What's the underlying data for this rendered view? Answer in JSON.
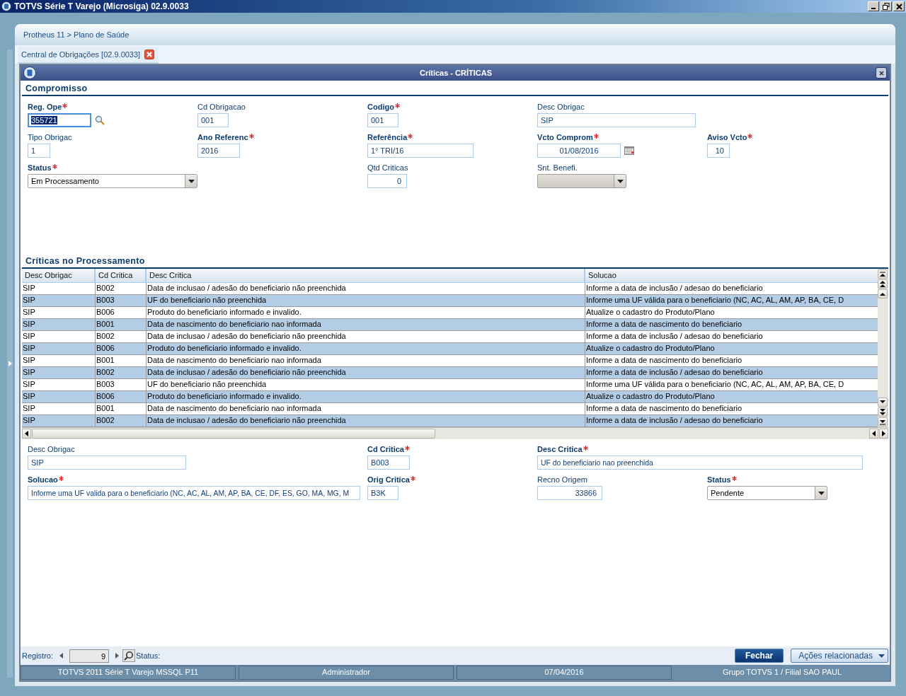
{
  "window": {
    "title": "TOTVS Série T Varejo (Microsiga) 02.9.0033"
  },
  "breadcrumb": "Protheus 11 > Plano de Saúde",
  "tabs": [
    {
      "label": "Central de Obrigações [02.9.0033]",
      "selected": true
    }
  ],
  "dialog": {
    "title": "Críticas - CRÍTICAS",
    "header_section": {
      "title": "Compromisso",
      "fields": [
        {
          "label": "Reg. Ope",
          "required": true,
          "kind": "lookup",
          "value": "355721",
          "focused": true,
          "disabled": false
        },
        {
          "label": "Cd Obrigacao",
          "required": false,
          "kind": "text",
          "value": "001",
          "focused": false,
          "disabled": false
        },
        {
          "label": "Codigo",
          "required": true,
          "kind": "text",
          "value": "001",
          "focused": false,
          "disabled": false
        },
        {
          "label": "Desc Obrigac",
          "required": false,
          "kind": "text",
          "value": "SIP",
          "focused": false,
          "disabled": false
        },
        {
          "label": "Tipo Obrigac",
          "required": false,
          "kind": "text",
          "value": "1",
          "focused": false,
          "disabled": false
        },
        {
          "label": "Ano Referenc",
          "required": true,
          "kind": "text",
          "value": "2016",
          "focused": false,
          "disabled": false
        },
        {
          "label": "Referência",
          "required": true,
          "kind": "text",
          "value": "1° TRI/16",
          "focused": false,
          "disabled": false
        },
        {
          "label": "Vcto Comprom",
          "required": true,
          "kind": "date",
          "value": "01/08/2016",
          "focused": false,
          "disabled": false
        },
        {
          "label": "Aviso Vcto",
          "required": true,
          "kind": "number",
          "value": "10",
          "focused": false,
          "disabled": false
        },
        {
          "label": "Status",
          "required": true,
          "kind": "select",
          "value": "Em Processamento",
          "focused": false,
          "disabled": false
        },
        {
          "label": "Qtd Criticas",
          "required": false,
          "kind": "number",
          "value": "0",
          "focused": false,
          "disabled": false
        },
        {
          "label": "Snt. Benefi.",
          "required": false,
          "kind": "select",
          "focused": false,
          "disabled": true
        }
      ]
    },
    "grid_section": {
      "title": "Críticas no Processamento",
      "table": {
        "columns": [
          "Desc Obrigac",
          "Cd Critica",
          "Desc Critica",
          "Solucao"
        ],
        "rows": [
          [
            "SIP",
            "B002",
            "Data de inclusao / adesão do beneficiario não preenchida",
            "Informe a data de inclusão / adesao do beneficiario"
          ],
          [
            "SIP",
            "B003",
            "UF do beneficiario não preenchida",
            "Informe uma UF válida para o beneficiario (NC, AC, AL, AM, AP, BA, CE, D"
          ],
          [
            "SIP",
            "B006",
            "Produto do beneficiario informado e invalido.",
            "Atualize o cadastro do Produto/Plano"
          ],
          [
            "SIP",
            "B001",
            "Data de nascimento do beneficiario nao informada",
            "Informe a data de nascimento do beneficiario"
          ],
          [
            "SIP",
            "B002",
            "Data de inclusao / adesão do beneficiario não preenchida",
            "Informe a data de inclusão / adesao do beneficiario"
          ],
          [
            "SIP",
            "B006",
            "Produto do beneficiario informado e invalido.",
            "Atualize o cadastro do Produto/Plano"
          ],
          [
            "SIP",
            "B001",
            "Data de nascimento do beneficiario nao informada",
            "Informe a data de nascimento do beneficiario"
          ],
          [
            "SIP",
            "B002",
            "Data de inclusao / adesão do beneficiario não preenchida",
            "Informe a data de inclusão / adesao do beneficiario"
          ],
          [
            "SIP",
            "B003",
            "UF do beneficiario não preenchida",
            "Informe uma UF válida para o beneficiario (NC, AC, AL, AM, AP, BA, CE, D"
          ],
          [
            "SIP",
            "B006",
            "Produto do beneficiario informado e invalido.",
            "Atualize o cadastro do Produto/Plano"
          ],
          [
            "SIP",
            "B001",
            "Data de nascimento do beneficiario nao informada",
            "Informe a data de nascimento do beneficiario"
          ],
          [
            "SIP",
            "B002",
            "Data de inclusao / adesão do beneficiario não preenchida",
            "Informe a data de inclusão / adesao do beneficiario"
          ]
        ]
      }
    },
    "detail": {
      "fields": [
        {
          "label": "Desc Obrigac",
          "required": false,
          "kind": "text",
          "value": "SIP",
          "focused": false,
          "disabled": false
        },
        {
          "label": "Cd Critica",
          "required": true,
          "kind": "text",
          "value": "B003",
          "focused": false,
          "disabled": false
        },
        {
          "label": "Desc Critica",
          "required": true,
          "kind": "text",
          "value": "UF do beneficiario nao preenchida",
          "focused": false,
          "disabled": false
        },
        {
          "label": "Solucao",
          "required": true,
          "kind": "text",
          "value": "Informe uma UF valida para o beneficiario (NC, AC, AL, AM, AP, BA, CE, DF, ES, GO, MA, MG, M",
          "focused": false,
          "disabled": false
        },
        {
          "label": "Orig Critica",
          "required": true,
          "kind": "text",
          "value": "B3K",
          "focused": false,
          "disabled": false
        },
        {
          "label": "Recno Origem",
          "required": false,
          "kind": "number",
          "value": "33866",
          "focused": false,
          "disabled": false
        },
        {
          "label": "Status",
          "required": true,
          "kind": "select",
          "value": "Pendente",
          "focused": false,
          "disabled": false
        }
      ]
    },
    "footer": {
      "record_label": "Registro:",
      "record": "9",
      "status_label": "Status:",
      "buttons": [
        {
          "label": "Fechar",
          "kind": "primary"
        },
        {
          "label": "Ações relacionadas",
          "kind": "menu"
        }
      ]
    }
  },
  "status_bar": [
    "TOTVS 2011 Série T Varejo MSSQL P11",
    "Administrador",
    "07/04/2016",
    "Grupo TOTVS 1 / Filial SAO PAUL"
  ]
}
